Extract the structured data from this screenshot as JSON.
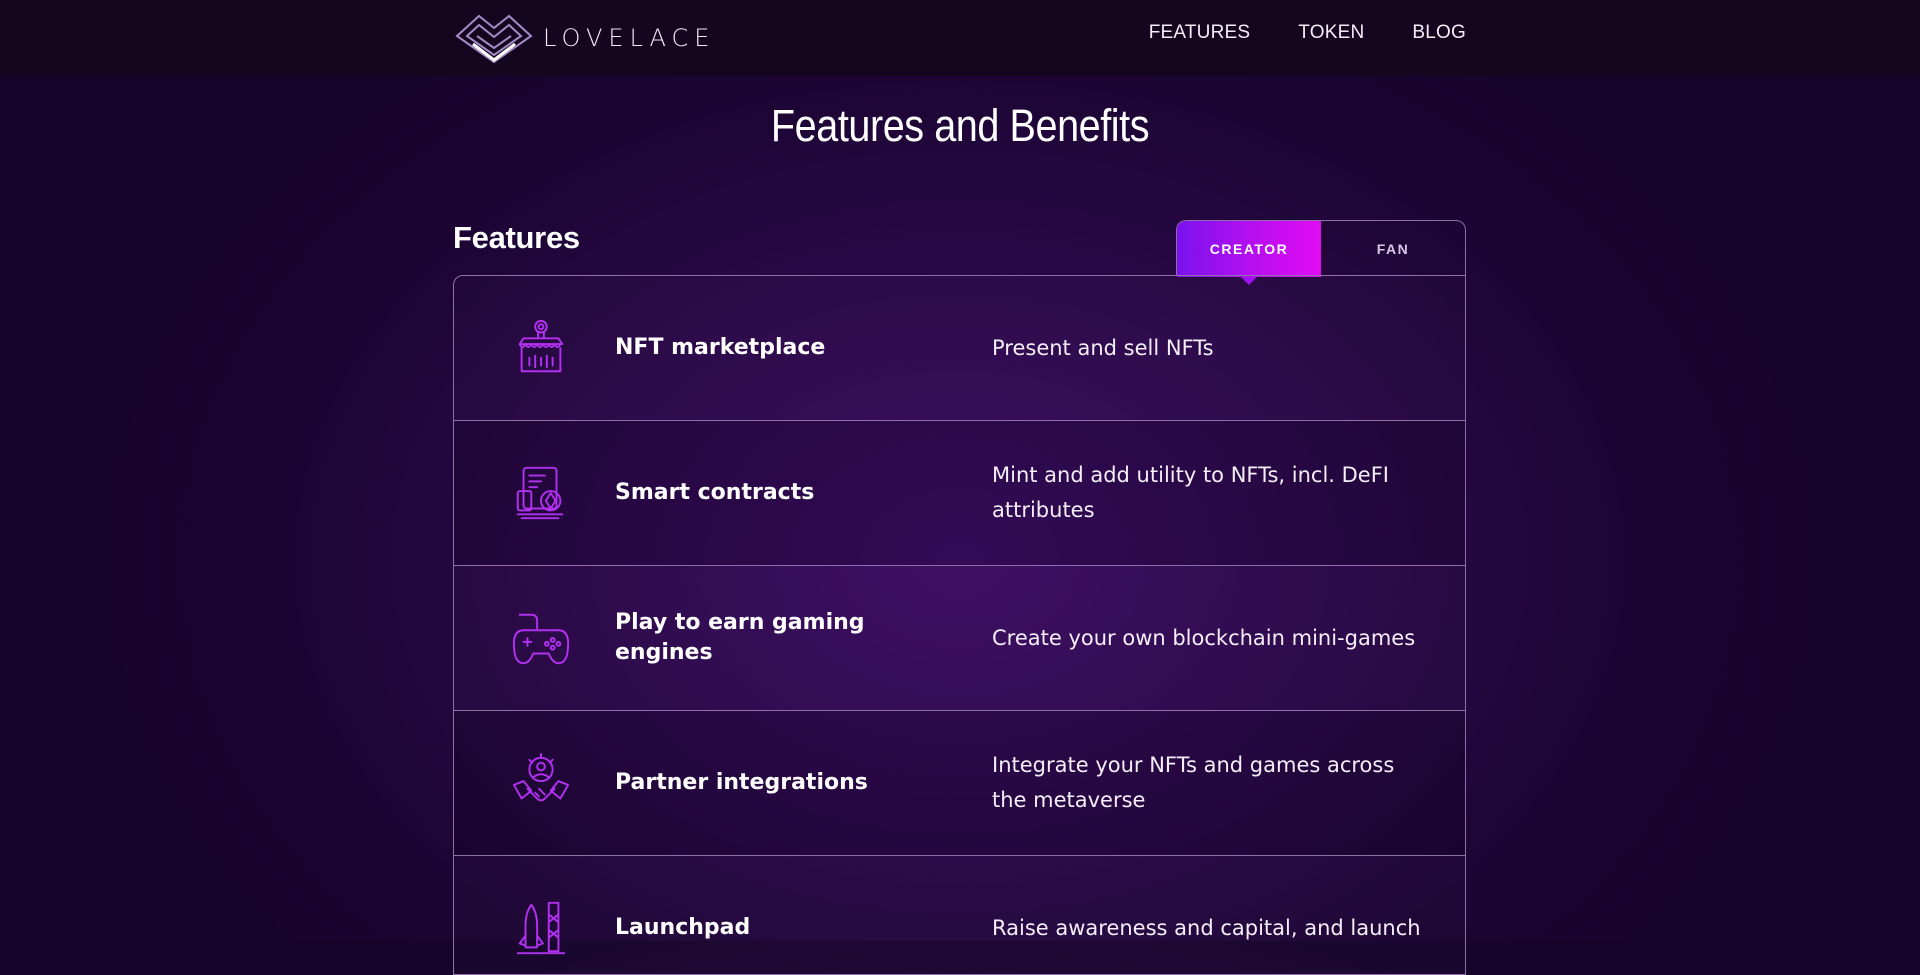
{
  "header": {
    "brand": "LOVELACE",
    "nav": [
      {
        "label": "FEATURES"
      },
      {
        "label": "TOKEN"
      },
      {
        "label": "BLOG"
      }
    ]
  },
  "page_title": "Features and Benefits",
  "section_title": "Features",
  "tabs": [
    {
      "label": "CREATOR",
      "active": true
    },
    {
      "label": "FAN",
      "active": false
    }
  ],
  "features": [
    {
      "icon": "storefront-icon",
      "name": "NFT marketplace",
      "description": "Present and sell NFTs"
    },
    {
      "icon": "smart-contract-icon",
      "name": "Smart contracts",
      "description": "Mint and add utility to NFTs, incl. DeFI attributes"
    },
    {
      "icon": "gamepad-icon",
      "name": "Play to earn gaming engines",
      "description": "Create your own blockchain mini-games"
    },
    {
      "icon": "handshake-icon",
      "name": "Partner integrations",
      "description": "Integrate your NFTs and games across the metaverse"
    },
    {
      "icon": "rocket-icon",
      "name": "Launchpad",
      "description": "Raise awareness and capital, and launch"
    }
  ],
  "colors": {
    "background": "#2a0848",
    "header": "#14061f",
    "accent_start": "#7a12ee",
    "accent_end": "#e10cf2",
    "icon": "#b230f0",
    "border": "#8e6fa8"
  }
}
